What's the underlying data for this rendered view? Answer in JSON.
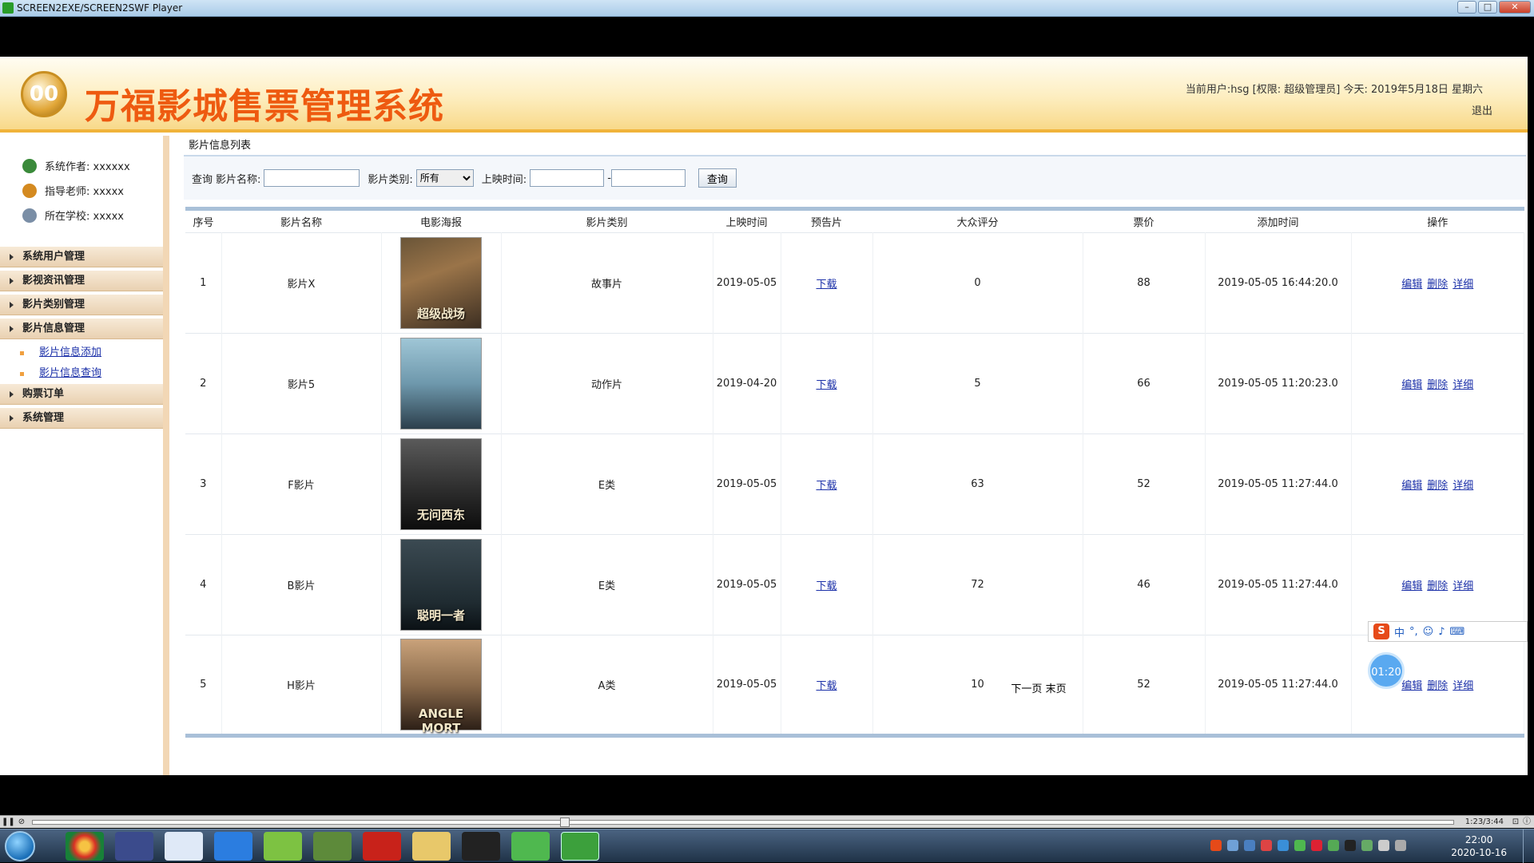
{
  "player": {
    "title": "SCREEN2EXE/SCREEN2SWF Player",
    "time": "1:23/3:44"
  },
  "header": {
    "emblem": "00",
    "title": "万福影城售票管理系统",
    "user_info": "当前用户:hsg [权限: 超级管理员] 今天: 2019年5月18日  星期六",
    "logout": "退出"
  },
  "sidebar": {
    "info": [
      {
        "label": "系统作者: xxxxxx",
        "icon": "person-icon",
        "color": "#3a8a3a"
      },
      {
        "label": "指导老师: xxxxx",
        "icon": "teacher-icon",
        "color": "#d48a20"
      },
      {
        "label": "所在学校: xxxxx",
        "icon": "school-icon",
        "color": "#7a8ea6"
      }
    ],
    "menu": [
      {
        "label": "系统用户管理"
      },
      {
        "label": "影视资讯管理"
      },
      {
        "label": "影片类别管理"
      },
      {
        "label": "影片信息管理"
      }
    ],
    "submenu": [
      "影片信息添加",
      "影片信息查询"
    ],
    "menu_after": [
      {
        "label": "购票订单"
      },
      {
        "label": "系统管理"
      }
    ]
  },
  "main": {
    "panel_title": "影片信息列表",
    "search": {
      "query_label": "查询",
      "name_label": "影片名称:",
      "type_label": "影片类别:",
      "type_selected": "所有",
      "date_label": "上映时间:",
      "dash": "-",
      "button": "查询"
    },
    "columns": [
      "序号",
      "影片名称",
      "电影海报",
      "影片类别",
      "上映时间",
      "预告片",
      "大众评分",
      "票价",
      "添加时间",
      "操作"
    ],
    "rows": [
      {
        "no": "1",
        "name": "影片X",
        "poster_text": "超级战场",
        "category": "故事片",
        "release": "2019-05-05",
        "trailer": "下载",
        "score": "0",
        "price": "88",
        "added": "2019-05-05 16:44:20.0"
      },
      {
        "no": "2",
        "name": "影片5",
        "poster_text": "",
        "category": "动作片",
        "release": "2019-04-20",
        "trailer": "下载",
        "score": "5",
        "price": "66",
        "added": "2019-05-05 11:20:23.0"
      },
      {
        "no": "3",
        "name": "F影片",
        "poster_text": "无问西东",
        "category": "E类",
        "release": "2019-05-05",
        "trailer": "下载",
        "score": "63",
        "price": "52",
        "added": "2019-05-05 11:27:44.0"
      },
      {
        "no": "4",
        "name": "B影片",
        "poster_text": "聪明一者",
        "category": "E类",
        "release": "2019-05-05",
        "trailer": "下载",
        "score": "72",
        "price": "46",
        "added": "2019-05-05 11:27:44.0"
      },
      {
        "no": "5",
        "name": "H影片",
        "poster_text": "ANGLE MORT",
        "category": "A类",
        "release": "2019-05-05",
        "trailer": "下载",
        "score": "10",
        "price": "52",
        "added": "2019-05-05 11:27:44.0"
      }
    ],
    "actions": {
      "edit": "编辑",
      "delete": "删除",
      "detail": "详细"
    },
    "pager": {
      "next": "下一页",
      "last": "末页"
    }
  },
  "overlay": {
    "ime_label": "中",
    "timer": "01:20"
  },
  "taskbar": {
    "clock_time": "22:00",
    "clock_date": "2020-10-16"
  }
}
